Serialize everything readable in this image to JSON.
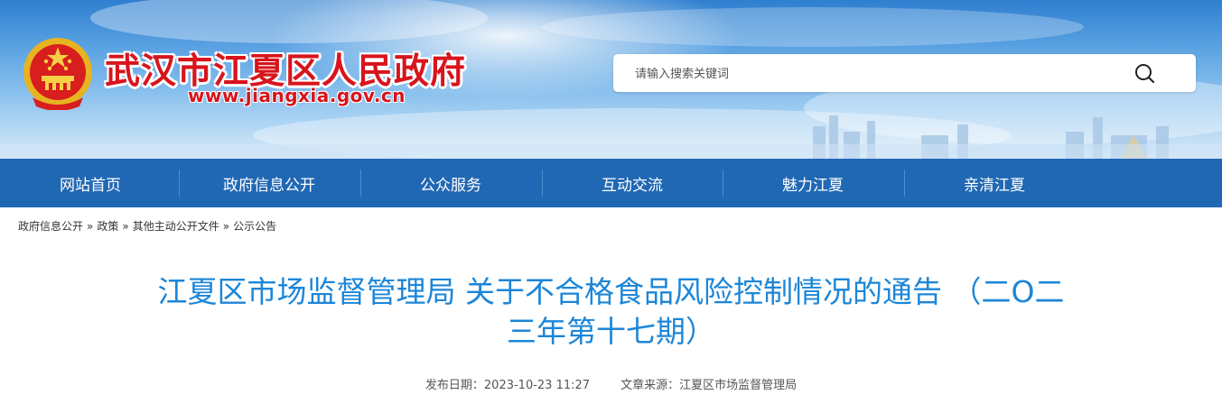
{
  "header": {
    "site_title": "武汉市江夏区人民政府",
    "site_url": "www.jiangxia.gov.cn",
    "emblem_icon": "national-emblem-icon",
    "search": {
      "placeholder": "请输入搜索关键词",
      "value": "",
      "icon": "search-icon"
    }
  },
  "nav": {
    "items": [
      {
        "label": "网站首页"
      },
      {
        "label": "政府信息公开"
      },
      {
        "label": "公众服务"
      },
      {
        "label": "互动交流"
      },
      {
        "label": "魅力江夏"
      },
      {
        "label": "亲清江夏"
      }
    ]
  },
  "breadcrumb": {
    "items": [
      {
        "label": "政府信息公开"
      },
      {
        "label": "政策"
      },
      {
        "label": "其他主动公开文件"
      },
      {
        "label": "公示公告"
      }
    ],
    "separator": "»"
  },
  "article": {
    "title_line1": "江夏区市场监督管理局 关于不合格食品风险控制情况的通告 （二O二",
    "title_line2": "三年第十七期）",
    "publish_date_label": "发布日期：",
    "publish_date": "2023-10-23 11:27",
    "source_label": "文章来源：",
    "source": "江夏区市场监督管理局"
  },
  "colors": {
    "nav_bg": "#2168b4",
    "title_blue": "#1c86d8",
    "site_red": "#d8141c"
  }
}
